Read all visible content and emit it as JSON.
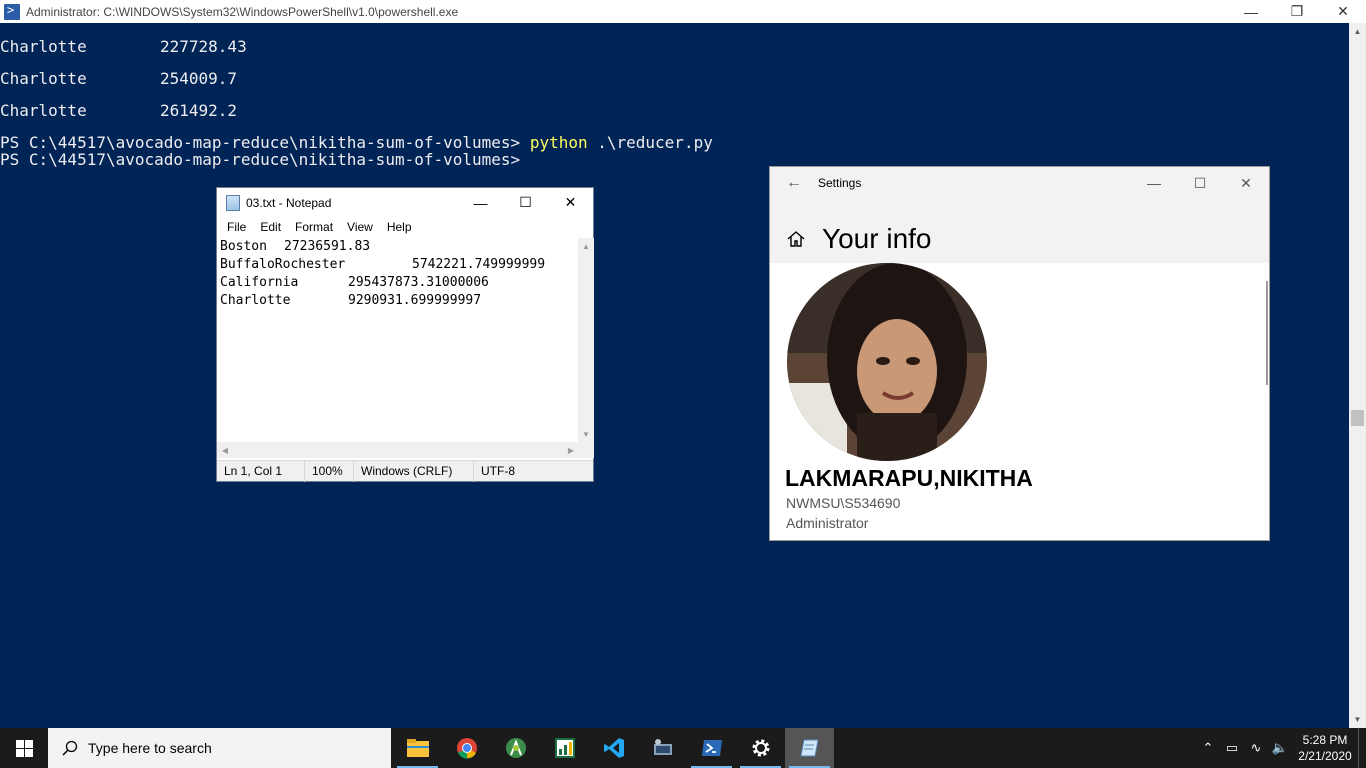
{
  "powershell": {
    "title": "Administrator: C:\\WINDOWS\\System32\\WindowsPowerShell\\v1.0\\powershell.exe",
    "output": [
      {
        "city": "Charlotte",
        "value": "227728.43"
      },
      {
        "city": "Charlotte",
        "value": "254009.7"
      },
      {
        "city": "Charlotte",
        "value": "261492.2"
      }
    ],
    "prompt1": {
      "path": "PS C:\\44517\\avocado-map-reduce\\nikitha-sum-of-volumes> ",
      "command": "python",
      "args": " .\\reducer.py"
    },
    "prompt2": {
      "path": "PS C:\\44517\\avocado-map-reduce\\nikitha-sum-of-volumes>"
    },
    "colors": {
      "background": "#012456",
      "text": "#eeedf0",
      "command": "#ffff60"
    }
  },
  "notepad": {
    "title": "03.txt - Notepad",
    "menu": [
      "File",
      "Edit",
      "Format",
      "View",
      "Help"
    ],
    "lines": [
      {
        "name": "Boston",
        "value": "27236591.83"
      },
      {
        "name": "BuffaloRochester",
        "value": "5742221.749999999"
      },
      {
        "name": "California",
        "value": "295437873.31000006"
      },
      {
        "name": "Charlotte",
        "value": "9290931.699999997"
      }
    ],
    "status": {
      "position": "Ln 1, Col 1",
      "zoom": "100%",
      "line_ending": "Windows (CRLF)",
      "encoding": "UTF-8"
    }
  },
  "settings": {
    "title": "Settings",
    "page_title": "Your info",
    "user_name": "LAKMARAPU,NIKITHA",
    "user_id": "NWMSU\\S534690",
    "user_role": "Administrator"
  },
  "taskbar": {
    "search_placeholder": "Type here to search",
    "apps": [
      "file-explorer",
      "chrome",
      "android-studio",
      "spreadsheet",
      "vs-code",
      "network-tool",
      "powershell",
      "settings",
      "notepad"
    ],
    "time": "5:28 PM",
    "date": "2/21/2020"
  }
}
